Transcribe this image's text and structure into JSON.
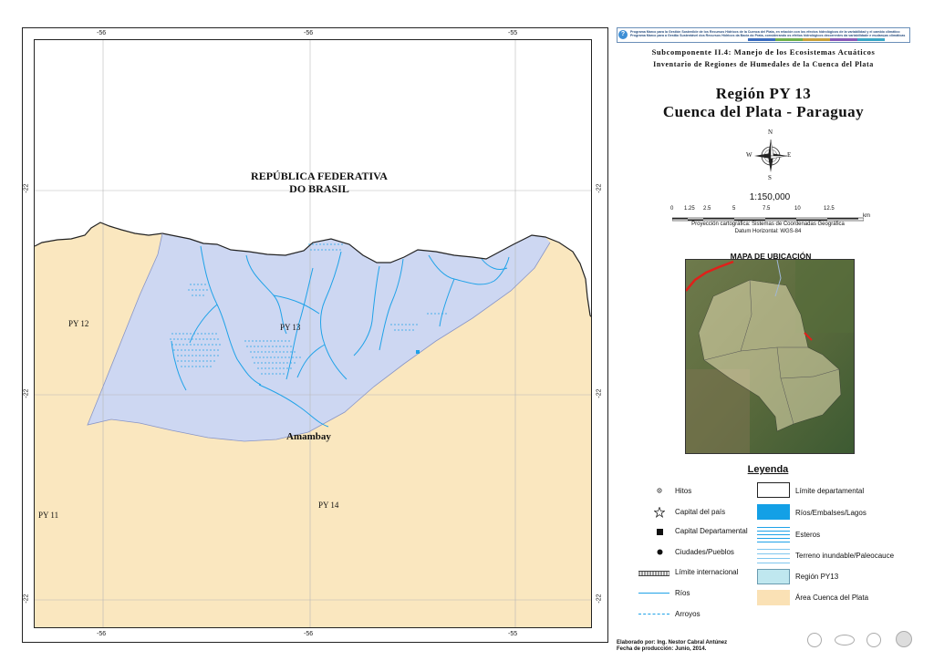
{
  "map": {
    "grid_labels": {
      "top": [
        "-56",
        "-56",
        "-55"
      ],
      "bottom": [
        "-56",
        "-56",
        "-55"
      ],
      "left": [
        "-22",
        "-22",
        "-22"
      ],
      "right": [
        "-22",
        "-22",
        "-22"
      ]
    },
    "labels": {
      "brasil_line1": "REPÚBLICA FEDERATIVA",
      "brasil_line2": "DO BRASIL",
      "py13": "PY 13",
      "py12": "PY 12",
      "py11": "PY 11",
      "py14": "PY 14",
      "amambay": "Amambay"
    },
    "colors": {
      "cuenca": "#fae7bf",
      "region": "#cdd7f2",
      "rivers": "#1fa2e8",
      "boundary": "#222222"
    }
  },
  "header": {
    "banner_line1": "Programa Marco para la Gestión Sostenible de los Recursos Hídricos de la Cuenca del Plata, en relación con los efectos hidrológicos de la variabilidad y el cambio climático",
    "banner_line2": "Programa Marco para a Gestão Sustentável dos Recursos Hídricos da Bacia do Prata, considerando os efeitos hidrológicos decorrentes da variabilidade e mudanças climáticas",
    "subcomponent": "Subcomponente II.4: Manejo de los Ecosistemas Acuáticos",
    "inventory": "Inventario de Regiones de Humedales de la Cuenca del Plata",
    "title1": "Región PY 13",
    "title2": "Cuenca del Plata - Paraguay"
  },
  "compass": {
    "n": "N",
    "s": "S",
    "e": "E",
    "w": "W"
  },
  "scale": {
    "ratio": "1:150,000",
    "ticks": [
      "0",
      "1.25",
      "2.5",
      "5",
      "7.5",
      "10",
      "12.5"
    ],
    "unit": "km",
    "projection": "Proyección cartográfica: Sistemas de Coordenadas Geográfica",
    "datum": "Datum Horizontal: WGS-84"
  },
  "location_map": {
    "title": "MAPA DE UBICACIÓN"
  },
  "legend": {
    "title": "Leyenda",
    "left": [
      "Hitos",
      "Capital del país",
      "Capital Departamental",
      "Ciudades/Pueblos",
      "Límite internacional",
      "Ríos",
      "Arroyos"
    ],
    "right": [
      "Límite departamental",
      "Ríos/Embalses/Lagos",
      "Esteros",
      "Terreno inundable/Paleocauce",
      "Región PY13",
      "Área Cuenca del Plata"
    ]
  },
  "credits": {
    "line1": "Elaborado por: Ing. Nestor Cabral Antúnez",
    "line2": "Fecha de producción: Junio, 2014."
  }
}
